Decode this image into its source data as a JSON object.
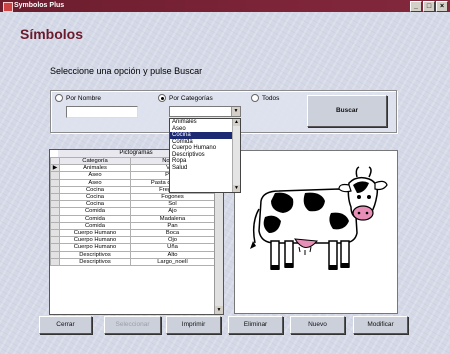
{
  "window": {
    "title": "Symbolos Plus",
    "controls": [
      "_",
      "□",
      "×"
    ]
  },
  "page": {
    "title": "Símbolos",
    "instruction": "Seleccione una opción y pulse Buscar"
  },
  "search": {
    "options": [
      {
        "label": "Por Nombre",
        "checked": false
      },
      {
        "label": "Por Categorías",
        "checked": true
      },
      {
        "label": "Todos",
        "checked": false
      }
    ],
    "name_value": "",
    "search_button": "Buscar"
  },
  "category_dropdown": {
    "items": [
      "Animales",
      "Aseo",
      "Cocina",
      "Comida",
      "Cuerpo Humano",
      "Descriptivos",
      "Ropa",
      "Salud"
    ],
    "selected_index": 2
  },
  "grid": {
    "group_header": "Pictogramas",
    "columns": [
      "Categoría",
      "Nombre"
    ],
    "current_row_index": 0,
    "rows": [
      [
        "Animales",
        "Vaca"
      ],
      [
        "Aseo",
        "Peine"
      ],
      [
        "Aseo",
        "Pasta de dientes"
      ],
      [
        "Cocina",
        "Fregadero"
      ],
      [
        "Cocina",
        "Fogones"
      ],
      [
        "Cocina",
        "Sol"
      ],
      [
        "Comida",
        "Ajo"
      ],
      [
        "Comida",
        "Madalena"
      ],
      [
        "Comida",
        "Pan"
      ],
      [
        "Cuerpo Humano",
        "Boca"
      ],
      [
        "Cuerpo Humano",
        "Ojo"
      ],
      [
        "Cuerpo Humano",
        "Uña"
      ],
      [
        "Descriptivos",
        "Alto"
      ],
      [
        "Descriptivos",
        "Largo_noelí"
      ]
    ]
  },
  "picture": {
    "subject": "cow",
    "icon": "cow-pictogram"
  },
  "actions": {
    "close": "Cerrar",
    "select": "Seleccionar",
    "print": "Imprimir",
    "delete": "Eliminar",
    "new": "Nuevo",
    "modify": "Modificar"
  },
  "colors": {
    "titlebar": "#7c2438",
    "title_text": "#6b1a2b",
    "selection": "#1c2a74"
  }
}
